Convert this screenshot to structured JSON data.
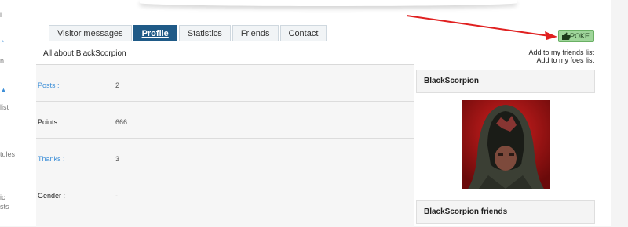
{
  "sidebar_fragments": [
    "l",
    "n",
    "list",
    "tules",
    "ic",
    "sts"
  ],
  "tabs": [
    {
      "label": "Visitor messages",
      "active": false
    },
    {
      "label": "Profile",
      "active": true
    },
    {
      "label": "Statistics",
      "active": false
    },
    {
      "label": "Friends",
      "active": false
    },
    {
      "label": "Contact",
      "active": false
    }
  ],
  "about_title": "All about BlackScorpion",
  "stats": [
    {
      "label": "Posts :",
      "value": "2",
      "is_link": true
    },
    {
      "label": "Points :",
      "value": "666",
      "is_link": false
    },
    {
      "label": "Thanks :",
      "value": "3",
      "is_link": true
    },
    {
      "label": "Gender :",
      "value": "-",
      "is_link": false
    }
  ],
  "poke": {
    "label": "POKE",
    "icon": "thumbs-up-icon",
    "color": "#9fd59a"
  },
  "actions": {
    "friends": "Add to my friends list",
    "foes": "Add to my foes list"
  },
  "profile": {
    "username": "BlackScorpion",
    "friends_title": "BlackScorpion friends"
  },
  "colors": {
    "active_tab": "#1f5a87",
    "link": "#3d8fd8",
    "arrow": "#e02020"
  }
}
